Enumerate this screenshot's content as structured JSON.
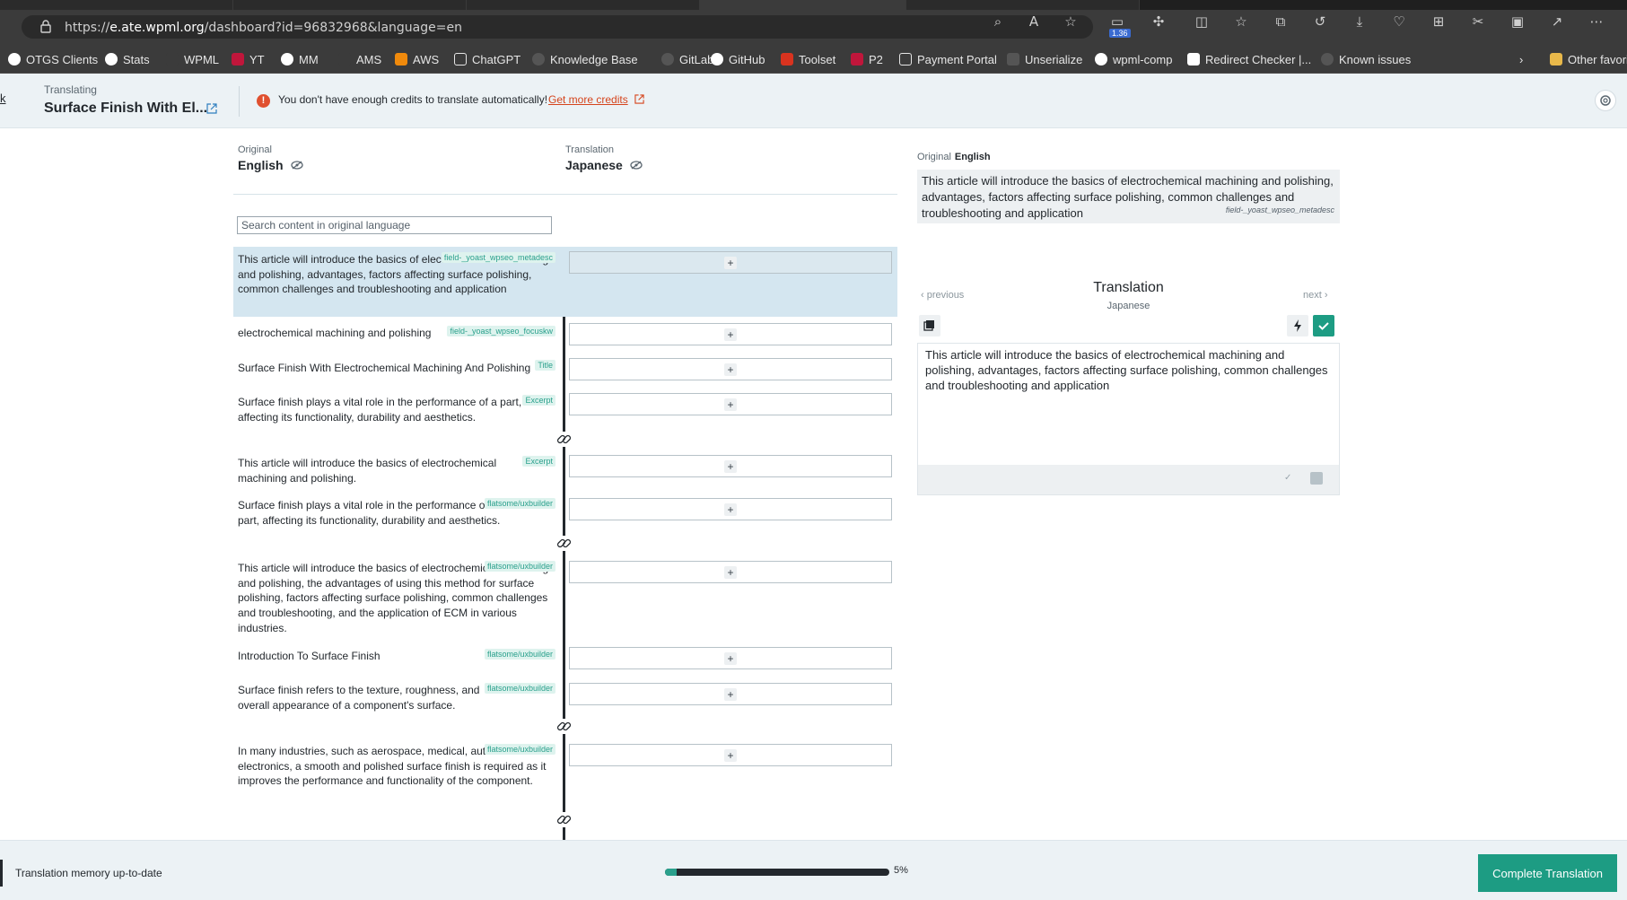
{
  "browser": {
    "url_prefix": "https://",
    "url_host": "e.ate.wpml.org",
    "url_path": "/dashboard?id=96832968&language=en",
    "badge": "1.36",
    "bookmarks": [
      {
        "label": "OTGS Clients",
        "color": "#ffffff"
      },
      {
        "label": "Stats",
        "color": "#ffffff"
      },
      {
        "label": "WPML",
        "color": "#3b3b3b"
      },
      {
        "label": "YT",
        "color": "#c0163b"
      },
      {
        "label": "MM",
        "color": "#ffffff"
      },
      {
        "label": "AMS",
        "color": "#3b3b3b"
      },
      {
        "label": "AWS",
        "color": "#f08a0c"
      },
      {
        "label": "ChatGPT",
        "color": "#3b3b3b"
      },
      {
        "label": "Knowledge Base",
        "color": "#555555"
      },
      {
        "label": "GitLab",
        "color": "#555555"
      },
      {
        "label": "GitHub",
        "color": "#ffffff"
      },
      {
        "label": "Toolset",
        "color": "#d9331f"
      },
      {
        "label": "P2",
        "color": "#c0163b"
      },
      {
        "label": "Payment Portal",
        "color": "#ffffff"
      },
      {
        "label": "Unserialize",
        "color": "#555555"
      },
      {
        "label": "wpml-comp",
        "color": "#ffffff"
      },
      {
        "label": "Redirect Checker |...",
        "color": "#ffffff"
      },
      {
        "label": "Known issues",
        "color": "#555555"
      }
    ],
    "other_favorites": "Other favori"
  },
  "header": {
    "back_label": "k",
    "translating_label": "Translating",
    "doc_title": "Surface Finish With El...",
    "credits_warning": "You don't have enough credits to translate automatically!",
    "get_credits": "Get more credits"
  },
  "columns": {
    "original_label": "Original",
    "original_lang": "English",
    "translation_label": "Translation",
    "translation_lang": "Japanese"
  },
  "search": {
    "placeholder": "Search content in original language"
  },
  "segments": [
    {
      "text": "This article will introduce the basics of electrochemical machining and polishing, advantages, factors affecting surface polishing, common challenges and troubleshooting and application",
      "tag": "field-_yoast_wpseo_metadesc"
    },
    {
      "text": "electrochemical machining and polishing",
      "tag": "field-_yoast_wpseo_focuskw"
    },
    {
      "text": "Surface Finish With Electrochemical Machining And Polishing",
      "tag": "Title"
    },
    {
      "text": "Surface finish plays a vital role in the performance of a part, affecting its functionality, durability and aesthetics.",
      "tag": "Excerpt"
    },
    {
      "text": "This article will introduce the basics of electrochemical machining and polishing.",
      "tag": "Excerpt"
    },
    {
      "text": "Surface finish plays a vital role in the performance of a part, affecting its functionality, durability and aesthetics.",
      "tag": "flatsome/uxbuilder"
    },
    {
      "text": "This article will introduce the basics of electrochemical machining and polishing, the advantages of using this method for surface polishing, factors affecting surface polishing, common challenges and troubleshooting, and the application of ECM in various industries.",
      "tag": "flatsome/uxbuilder"
    },
    {
      "text": "Introduction To Surface Finish",
      "tag": "flatsome/uxbuilder"
    },
    {
      "text": "Surface finish refers to the texture, roughness, and overall appearance of a component's surface.",
      "tag": "flatsome/uxbuilder"
    },
    {
      "text": "In many industries, such as aerospace, medical, automotive and electronics, a smooth and polished surface finish is required as it improves the performance and functionality of the component.",
      "tag": "flatsome/uxbuilder"
    }
  ],
  "panel": {
    "original_label": "Original",
    "original_lang": "English",
    "original_text": "This article will introduce the basics of electrochemical machining and polishing, advantages, factors affecting surface polishing, common challenges and troubleshooting and application",
    "original_field": "field-_yoast_wpseo_metadesc",
    "previous": "previous",
    "next": "next",
    "translation_title": "Translation",
    "translation_lang": "Japanese",
    "editor_text": "This article will introduce the basics of electrochemical machining and polishing, advantages, factors affecting surface polishing, common challenges and troubleshooting and application"
  },
  "footer": {
    "tm_status": "Translation memory up-to-date",
    "progress_percent": 5,
    "progress_label": "5%",
    "complete_button": "Complete Translation"
  },
  "colors": {
    "accent": "#1d9c83",
    "warning": "#e0502f",
    "active_row": "#d4e6f0"
  }
}
